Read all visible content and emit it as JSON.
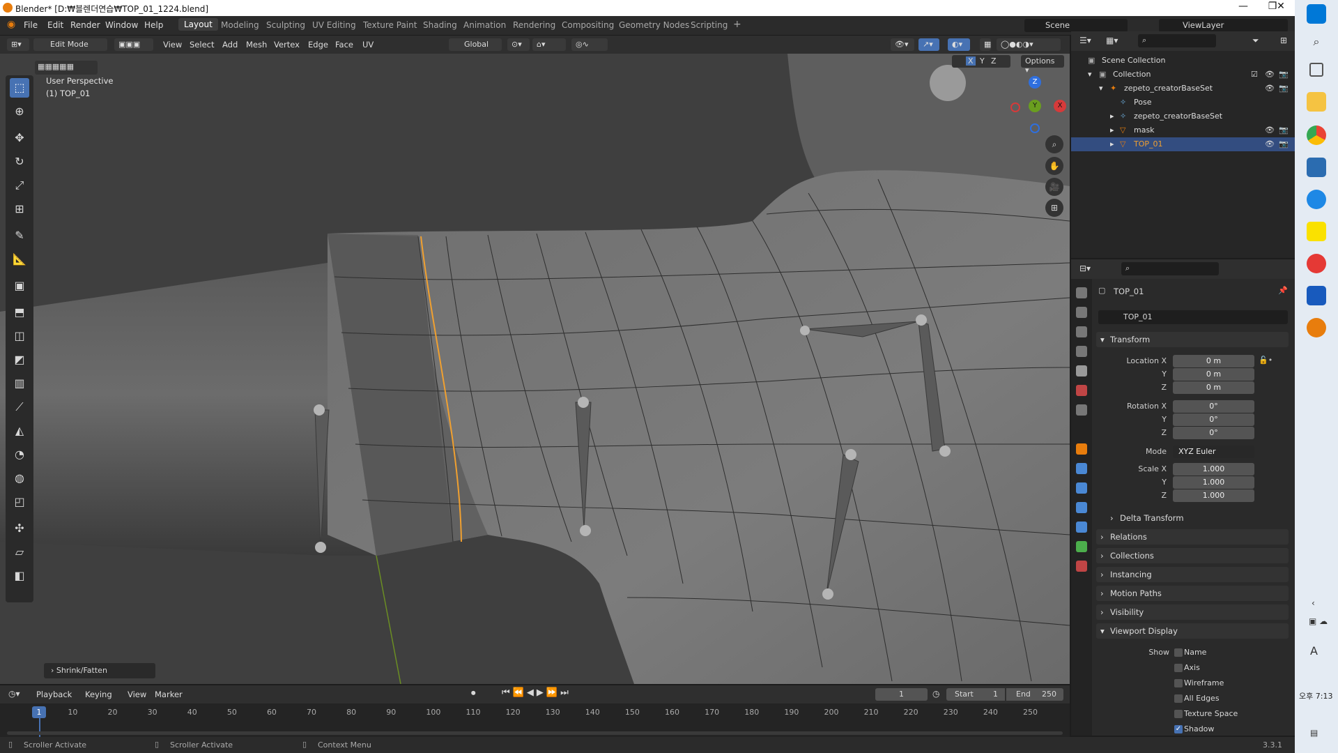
{
  "window": {
    "title": "Blender* [D:₩블렌더연습₩TOP_01_1224.blend]",
    "minimize": "—",
    "restore": "❐",
    "close": "✕"
  },
  "menu": {
    "items": [
      "File",
      "Edit",
      "Render",
      "Window",
      "Help"
    ],
    "workspaces": [
      "Layout",
      "Modeling",
      "Sculpting",
      "UV Editing",
      "Texture Paint",
      "Shading",
      "Animation",
      "Rendering",
      "Compositing",
      "Geometry Nodes",
      "Scripting"
    ],
    "active_workspace": "Layout",
    "add_tab": "+",
    "scene_label": "Scene",
    "viewlayer_label": "ViewLayer"
  },
  "viewport_header": {
    "mode": "Edit Mode",
    "menus": [
      "View",
      "Select",
      "Add",
      "Mesh",
      "Vertex",
      "Edge",
      "Face",
      "UV"
    ],
    "transform_orientation": "Global",
    "axes": [
      "X",
      "Y",
      "Z"
    ],
    "options": "Options"
  },
  "viewport": {
    "perspective": "User Perspective",
    "object_label": "(1) TOP_01",
    "operator_panel": "Shrink/Fatten",
    "gizmo": {
      "z": "Z",
      "y": "Y",
      "x": "X"
    }
  },
  "tools": [
    "select-box",
    "cursor",
    "move",
    "rotate",
    "scale",
    "transform",
    "annotate",
    "measure",
    "add-cube",
    "extrude",
    "inset",
    "bevel",
    "loop-cut",
    "knife",
    "poly-build",
    "spin",
    "smooth",
    "edge-slide",
    "shrink-fatten",
    "shear",
    "rip-region"
  ],
  "outliner": {
    "rows": [
      {
        "label": "Scene Collection",
        "indent": 0
      },
      {
        "label": "Collection",
        "indent": 1
      },
      {
        "label": "zepeto_creatorBaseSet",
        "indent": 2
      },
      {
        "label": "Pose",
        "indent": 3
      },
      {
        "label": "zepeto_creatorBaseSet",
        "indent": 3
      },
      {
        "label": "mask",
        "indent": 3
      },
      {
        "label": "TOP_01",
        "indent": 3,
        "selected": true
      }
    ]
  },
  "properties": {
    "object_name": "TOP_01",
    "object_field": "TOP_01",
    "transform_title": "Transform",
    "location_label": "Location X",
    "rotation_label": "Rotation X",
    "scale_label": "Scale X",
    "axis_y": "Y",
    "axis_z": "Z",
    "location": [
      "0 m",
      "0 m",
      "0 m"
    ],
    "rotation": [
      "0°",
      "0°",
      "0°"
    ],
    "mode_label": "Mode",
    "mode_value": "XYZ Euler",
    "scale": [
      "1.000",
      "1.000",
      "1.000"
    ],
    "delta_transform": "Delta Transform",
    "panels": [
      "Relations",
      "Collections",
      "Instancing",
      "Motion Paths",
      "Visibility"
    ],
    "viewport_display": "Viewport Display",
    "show_label": "Show",
    "show_options": [
      {
        "label": "Name",
        "checked": false
      },
      {
        "label": "Axis",
        "checked": false
      },
      {
        "label": "Wireframe",
        "checked": false
      },
      {
        "label": "All Edges",
        "checked": false
      },
      {
        "label": "Texture Space",
        "checked": false
      },
      {
        "label": "Shadow",
        "checked": true
      }
    ]
  },
  "timeline": {
    "menus": [
      "Playback",
      "Keying",
      "View",
      "Marker"
    ],
    "current_frame": "1",
    "start_label": "Start",
    "start_value": "1",
    "end_label": "End",
    "end_value": "250",
    "ticks": [
      "10",
      "20",
      "30",
      "40",
      "50",
      "60",
      "70",
      "80",
      "90",
      "100",
      "110",
      "120",
      "130",
      "140",
      "150",
      "160",
      "170",
      "180",
      "190",
      "200",
      "210",
      "220",
      "230",
      "240",
      "250"
    ],
    "playhead": "1"
  },
  "status": {
    "left1": "Scroller Activate",
    "left2": "Scroller Activate",
    "left3": "Context Menu",
    "version": "3.3.1"
  },
  "system_tray": {
    "time": "오후 7:13",
    "ime": "A"
  },
  "colors": {
    "accent": "#4772b3",
    "selected_edge": "#f0a030",
    "blender_orange": "#e87d0d"
  }
}
